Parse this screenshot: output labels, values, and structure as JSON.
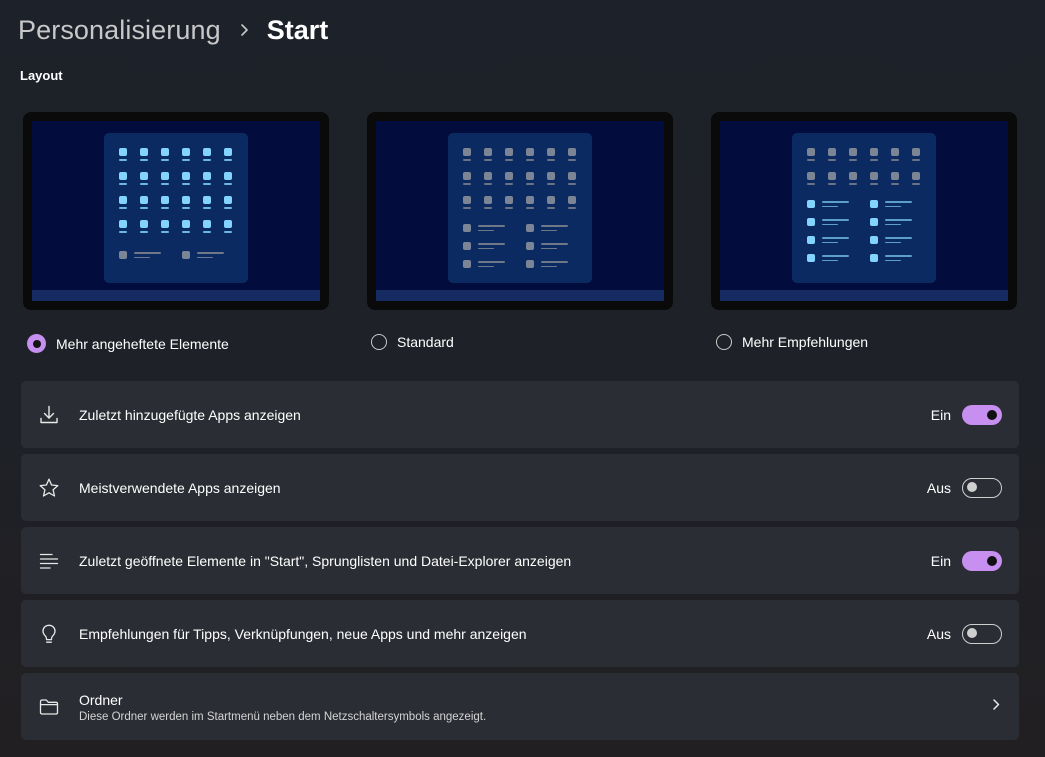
{
  "breadcrumb": {
    "parent": "Personalisierung",
    "current": "Start"
  },
  "section_label": "Layout",
  "layout_options": [
    {
      "label": "Mehr angeheftete Elemente",
      "selected": true
    },
    {
      "label": "Standard",
      "selected": false
    },
    {
      "label": "Mehr Empfehlungen",
      "selected": false
    }
  ],
  "settings": [
    {
      "icon": "download-icon",
      "title": "Zuletzt hinzugefügte Apps anzeigen",
      "state": "Ein",
      "on": true
    },
    {
      "icon": "star-icon",
      "title": "Meistverwendete Apps anzeigen",
      "state": "Aus",
      "on": false
    },
    {
      "icon": "list-icon",
      "title": "Zuletzt geöffnete Elemente in \"Start\", Sprunglisten und Datei-Explorer anzeigen",
      "state": "Ein",
      "on": true
    },
    {
      "icon": "lightbulb-icon",
      "title": "Empfehlungen für Tipps, Verknüpfungen, neue Apps und mehr anzeigen",
      "state": "Aus",
      "on": false
    }
  ],
  "folders": {
    "icon": "folder-icon",
    "title": "Ordner",
    "description": "Diese Ordner werden im Startmenü neben dem Netzschaltersymbols angezeigt."
  },
  "colors": {
    "accent": "#c68ff0",
    "card": "#2a2d33",
    "screen": "#020c3d",
    "startmenu": "#0c2a62"
  }
}
